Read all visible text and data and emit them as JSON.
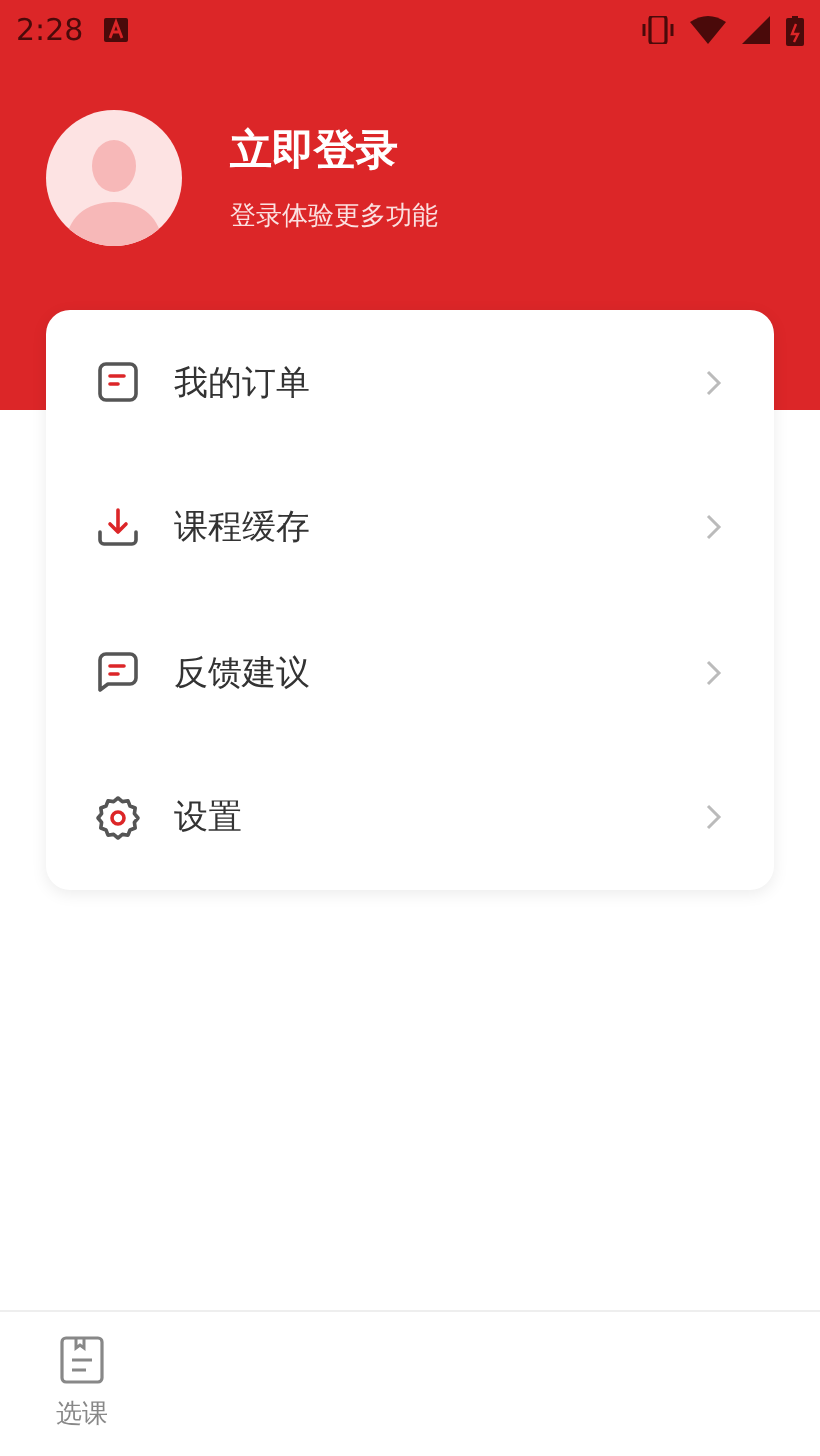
{
  "status_bar": {
    "time": "2:28"
  },
  "profile": {
    "title": "立即登录",
    "subtitle": "登录体验更多功能"
  },
  "menu": [
    {
      "kind": "orders",
      "label": "我的订单"
    },
    {
      "kind": "download",
      "label": "课程缓存"
    },
    {
      "kind": "feedback",
      "label": "反馈建议"
    },
    {
      "kind": "settings",
      "label": "设置"
    }
  ],
  "tab_bar": [
    {
      "label": "选课",
      "selected": false
    }
  ]
}
